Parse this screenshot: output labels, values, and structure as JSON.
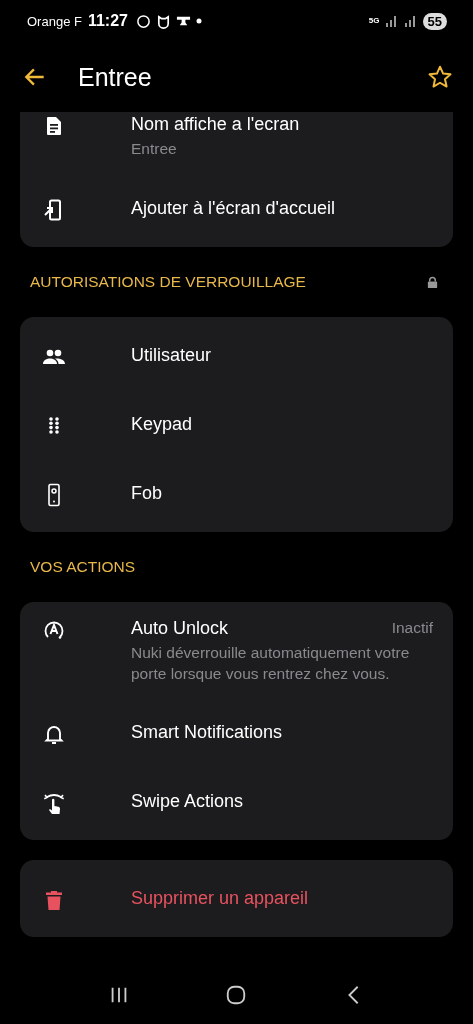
{
  "status_bar": {
    "carrier": "Orange F",
    "time": "11:27",
    "network": "5G",
    "battery": "55"
  },
  "app_bar": {
    "title": "Entree",
    "favorite": false
  },
  "sections": [
    {
      "top_clipped": true,
      "items": [
        {
          "kind": "display-name",
          "label": "Nom affiche a l'ecran",
          "subtitle": "Entree"
        },
        {
          "kind": "shortcut",
          "label": "Ajouter à l'écran d'accueil"
        }
      ]
    },
    {
      "header": "AUTORISATIONS DE VERROUILLAGE",
      "locked": true,
      "items": [
        {
          "kind": "user",
          "label": "Utilisateur"
        },
        {
          "kind": "keypad",
          "label": "Keypad"
        },
        {
          "kind": "fob",
          "label": "Fob"
        }
      ]
    },
    {
      "header": "VOS ACTIONS",
      "items": [
        {
          "kind": "auto-unlock",
          "label": "Auto Unlock",
          "value": "Inactif",
          "description": "Nuki déverrouille automatiquement votre porte lorsque vous rentrez chez vous."
        },
        {
          "kind": "notifications",
          "label": "Smart Notifications"
        },
        {
          "kind": "swipe",
          "label": "Swipe Actions"
        }
      ]
    },
    {
      "items": [
        {
          "kind": "delete",
          "label": "Supprimer un appareil",
          "danger": true
        }
      ]
    }
  ]
}
